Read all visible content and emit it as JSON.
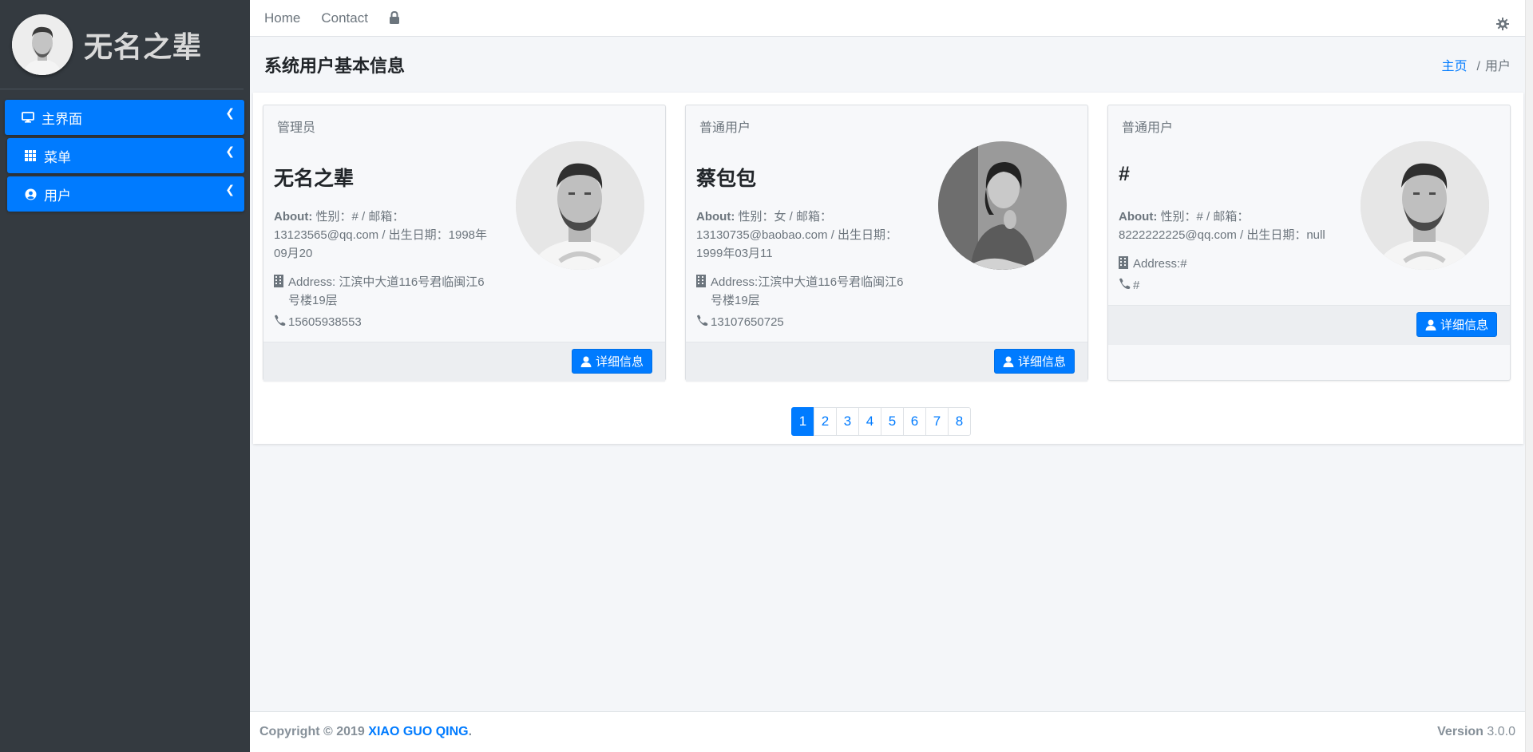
{
  "sidebar": {
    "brand_name": "无名之辈",
    "items": [
      {
        "label": "主界面",
        "icon": "desktop-icon"
      },
      {
        "label": "菜单",
        "icon": "grid-icon"
      },
      {
        "label": "用户",
        "icon": "user-circle-icon"
      }
    ]
  },
  "topbar": {
    "home": "Home",
    "contact": "Contact"
  },
  "header": {
    "title": "系统用户基本信息",
    "breadcrumb_home": "主页",
    "breadcrumb_sep": "/",
    "breadcrumb_current": "用户"
  },
  "cards": [
    {
      "role": "管理员",
      "name": "无名之辈",
      "about_label": "About:",
      "about_line1": "性别：# / 邮箱：",
      "about_line2": "13123565@qq.com / 出生日期：1998年",
      "about_line3": "09月20",
      "address_line1": "Address: 江滨中大道116号君临闽江6",
      "address_line2": "号楼19层",
      "phone": "15605938553",
      "button": "详细信息"
    },
    {
      "role": "普通用户",
      "name": "蔡包包",
      "about_label": "About:",
      "about_line1": "性别：女 / 邮箱：",
      "about_line2": "13130735@baobao.com / 出生日期：",
      "about_line3": "1999年03月11",
      "address_line1": "Address:江滨中大道116号君临闽江6",
      "address_line2": "号楼19层",
      "phone": "13107650725",
      "button": "详细信息"
    },
    {
      "role": "普通用户",
      "name": "#",
      "about_label": "About:",
      "about_line1": "性别：# / 邮箱：",
      "about_line2": "8222222225@qq.com / 出生日期：null",
      "about_line3": "",
      "address_line1": "Address:#",
      "address_line2": "",
      "phone": "#",
      "button": "详细信息"
    }
  ],
  "pagination": [
    "1",
    "2",
    "3",
    "4",
    "5",
    "6",
    "7",
    "8"
  ],
  "footer": {
    "copyright": "Copyright © 2019",
    "author": "XIAO GUO QING",
    "period": ".",
    "version_label": "Version",
    "version": "3.0.0"
  },
  "colors": {
    "primary": "#007bff",
    "sidebar": "#343a40"
  }
}
